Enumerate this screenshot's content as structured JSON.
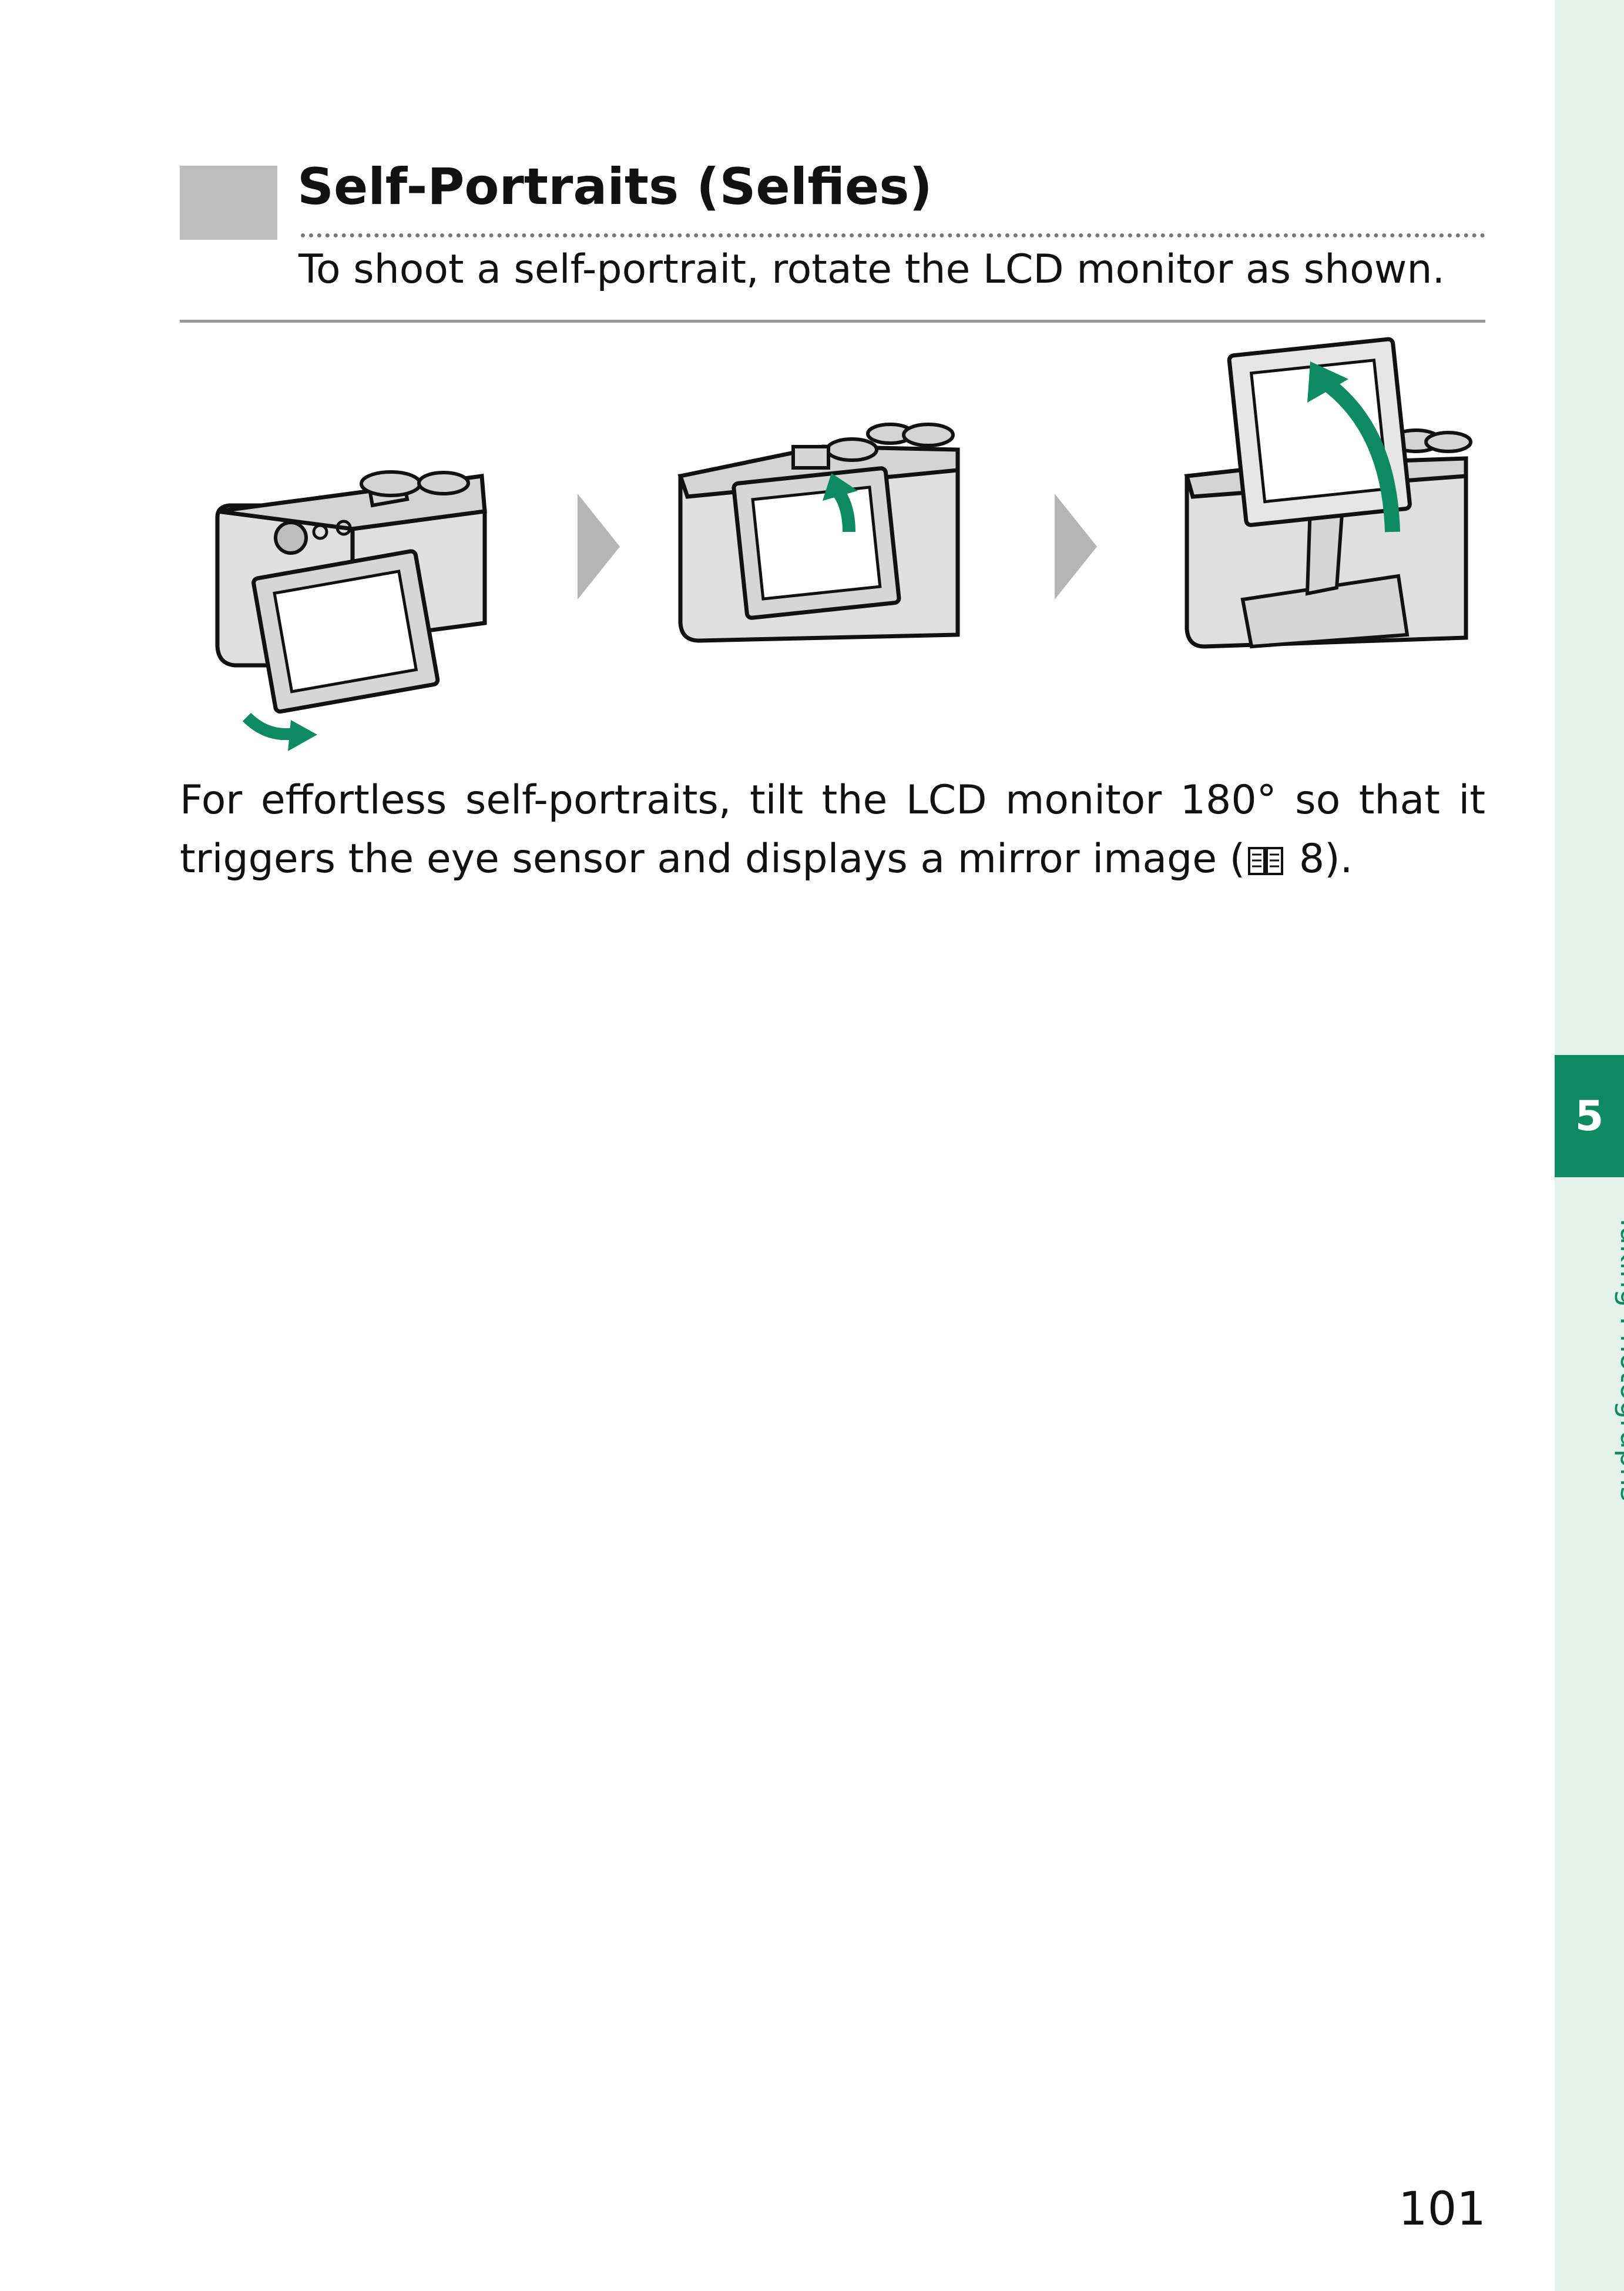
{
  "section": {
    "title": "Self-Portraits (Selfies)",
    "subtitle": "To shoot a self-portrait, rotate the LCD monitor as shown."
  },
  "body": {
    "text_before_icon": "For effortless self-portraits, tilt the LCD monitor 180° so that it triggers the eye sensor and displays a mirror image (",
    "icon": "book-reference-icon",
    "text_after_icon": " 8)."
  },
  "side_tab": {
    "chapter_number": "5",
    "chapter_title": "Taking Photographs"
  },
  "page_number": "101",
  "colors": {
    "accent": "#0e8a62",
    "side_tab_bg": "#e3f3ec",
    "heading_marker": "#bdbdbd",
    "camera_body": "#e0e0e0",
    "step_arrow": "#b5b5b5"
  }
}
